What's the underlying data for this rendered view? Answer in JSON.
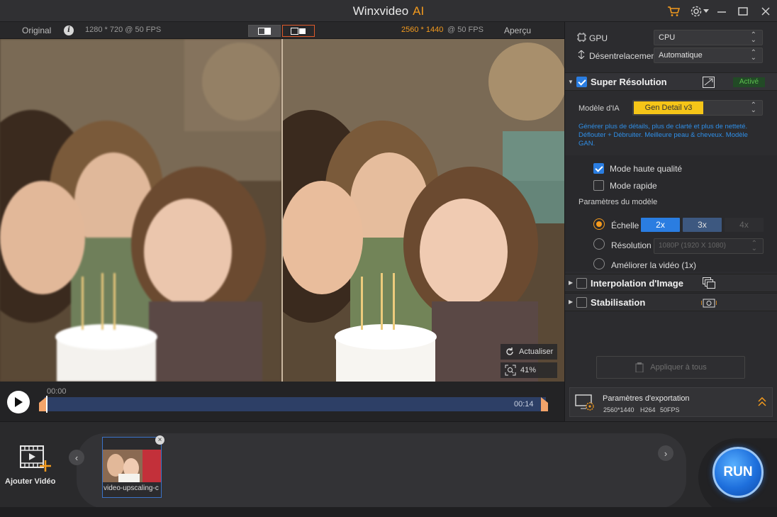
{
  "app": {
    "title": "Winxvideo",
    "title_ai": "AI"
  },
  "preview_header": {
    "original_label": "Original",
    "original_info": "1280 * 720 @ 50 FPS",
    "output_res": "2560 * 1440",
    "output_fps": "@ 50 FPS",
    "preview_label": "Aperçu"
  },
  "video": {
    "refresh_label": "Actualiser",
    "zoom_label": "41%"
  },
  "timeline": {
    "start": "00:00",
    "end": "00:14"
  },
  "panel": {
    "gpu_label": "GPU",
    "gpu_value": "CPU",
    "deinterlace_label": "Désentrelacement",
    "deinterlace_value": "Automatique",
    "super_res_label": "Super Résolution",
    "active_badge": "Activé",
    "model_label": "Modèle d'IA",
    "model_value": "Gen Detail v3",
    "model_desc": "Générer plus de détails, plus de clarté et plus de netteté. Déflouter + Débruiter. Meilleure peau & cheveux. Modèle GAN.",
    "high_quality": "Mode haute qualité",
    "fast_mode": "Mode rapide",
    "model_params": "Paramètres du modèle",
    "scale_label": "Échelle",
    "scale_options": [
      "2x",
      "3x",
      "4x"
    ],
    "resolution_label": "Résolution",
    "resolution_value": "1080P (1920 X 1080)",
    "enhance_label": "Améliorer la vidéo (1x)",
    "interpolation_label": "Interpolation d'Image",
    "stabilization_label": "Stabilisation",
    "apply_all": "Appliquer à tous"
  },
  "export": {
    "title": "Paramètres d'exportation",
    "resolution": "2560*1440",
    "codec": "H264",
    "fps": "50FPS"
  },
  "bottom": {
    "add_video": "Ajouter Vidéo",
    "thumb_name": "video-upscaling-c",
    "run_label": "RUN"
  },
  "colors": {
    "accent": "#f39a1e",
    "blue": "#2a7de1",
    "active_green": "#5cc04f",
    "model_yellow": "#f5c518"
  }
}
